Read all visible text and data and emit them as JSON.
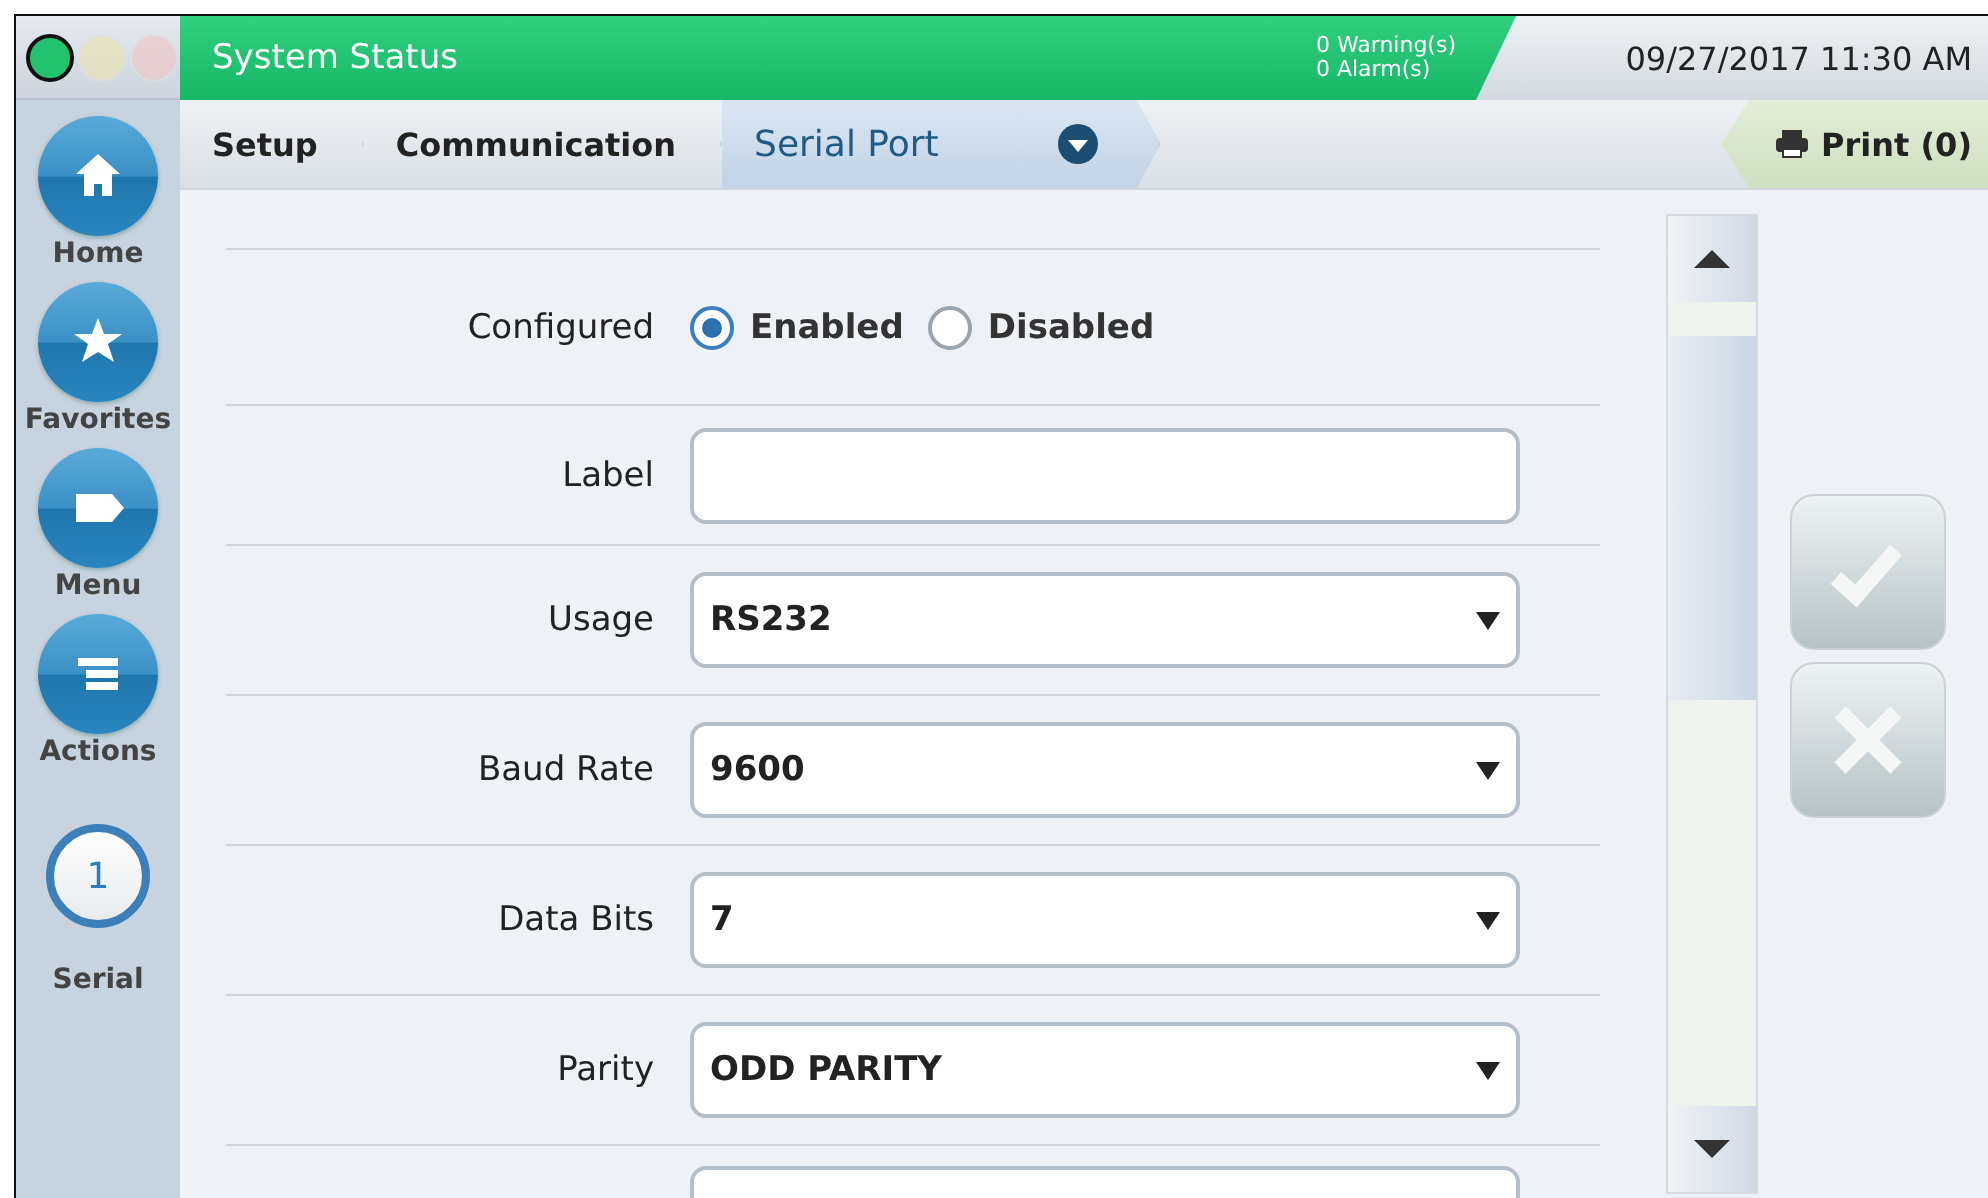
{
  "status_lights": [
    {
      "color": "#22c36e",
      "on": true
    },
    {
      "color": "#e8e2b8",
      "on": false
    },
    {
      "color": "#eccaca",
      "on": false
    }
  ],
  "header": {
    "title": "System Status",
    "warnings": "0 Warning(s)",
    "alarms": "0 Alarm(s)",
    "datetime": "09/27/2017 11:30 AM"
  },
  "breadcrumb": [
    {
      "label": "Setup",
      "selected": false
    },
    {
      "label": "Communication",
      "selected": false
    },
    {
      "label": "Serial Port",
      "selected": true
    }
  ],
  "print_button": "Print (0)",
  "sidebar": {
    "items": [
      {
        "kind": "home",
        "label": "Home"
      },
      {
        "kind": "star",
        "label": "Favorites"
      },
      {
        "kind": "menu",
        "label": "Menu"
      },
      {
        "kind": "actions",
        "label": "Actions"
      }
    ],
    "port": {
      "number": "1",
      "label": "Serial"
    }
  },
  "form": [
    {
      "kind": "radio",
      "label": "Configured",
      "options": [
        {
          "label": "Enabled",
          "selected": true
        },
        {
          "label": "Disabled",
          "selected": false
        }
      ]
    },
    {
      "kind": "text",
      "label": "Label"
    },
    {
      "kind": "select",
      "label": "Usage",
      "value": "RS232"
    },
    {
      "kind": "select",
      "label": "Baud Rate",
      "value": "9600"
    },
    {
      "kind": "select",
      "label": "Data Bits",
      "value": "7"
    },
    {
      "kind": "select",
      "label": "Parity",
      "value": "ODD PARITY"
    },
    {
      "kind": "partial"
    }
  ]
}
